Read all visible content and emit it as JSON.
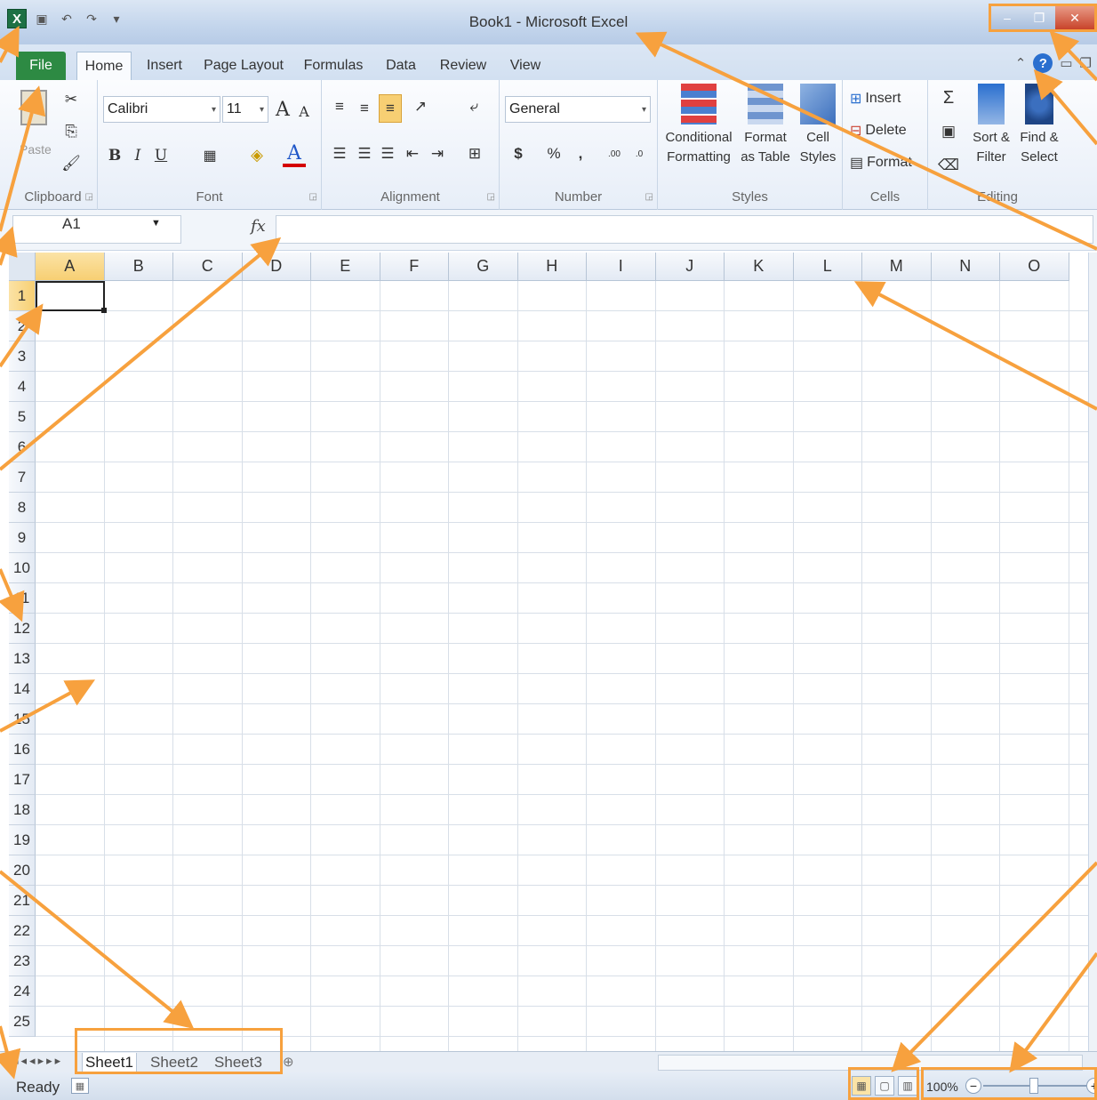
{
  "window": {
    "title": "Book1 - Microsoft Excel"
  },
  "qat": {
    "logo": "X",
    "items": [
      "save-icon",
      "undo-icon",
      "redo-icon",
      "customize-icon"
    ]
  },
  "ribbon_tabs": [
    "File",
    "Home",
    "Insert",
    "Page Layout",
    "Formulas",
    "Data",
    "Review",
    "View"
  ],
  "ribbon": {
    "clipboard": {
      "label": "Clipboard",
      "paste": "Paste"
    },
    "font": {
      "label": "Font",
      "name": "Calibri",
      "size": "11",
      "bold": "B",
      "italic": "I",
      "underline": "U",
      "grow": "A",
      "shrink": "A",
      "color": "A"
    },
    "alignment": {
      "label": "Alignment"
    },
    "number": {
      "label": "Number",
      "format": "General",
      "currency": "$",
      "percent": "%",
      "comma": ",",
      "inc": ".00",
      "dec": ".0"
    },
    "styles": {
      "label": "Styles",
      "conditional": [
        "Conditional",
        "Formatting"
      ],
      "format_table": [
        "Format",
        "as Table"
      ],
      "cell_styles": [
        "Cell",
        "Styles"
      ]
    },
    "cells": {
      "label": "Cells",
      "insert": "Insert",
      "delete": "Delete",
      "format": "Format"
    },
    "editing": {
      "label": "Editing",
      "sigma": "Σ",
      "sort": [
        "Sort &",
        "Filter"
      ],
      "find": [
        "Find &",
        "Select"
      ]
    }
  },
  "formula_bar": {
    "name_box": "A1",
    "fx": "fx",
    "value": ""
  },
  "grid": {
    "columns": [
      "A",
      "B",
      "C",
      "D",
      "E",
      "F",
      "G",
      "H",
      "I",
      "J",
      "K",
      "L",
      "M",
      "N",
      "O"
    ],
    "rows": [
      "1",
      "2",
      "3",
      "4",
      "5",
      "6",
      "7",
      "8",
      "9",
      "10",
      "11",
      "12",
      "13",
      "14",
      "15",
      "16",
      "17",
      "18",
      "19",
      "20",
      "21",
      "22",
      "23",
      "24",
      "25"
    ],
    "active_cell": "A1"
  },
  "sheet_tabs": [
    "Sheet1",
    "Sheet2",
    "Sheet3"
  ],
  "status": {
    "ready": "Ready",
    "zoom": "100%"
  },
  "colors": {
    "accent": "#f7a13e",
    "file_tab": "#2d8a43",
    "selection": "#f7cf73"
  }
}
